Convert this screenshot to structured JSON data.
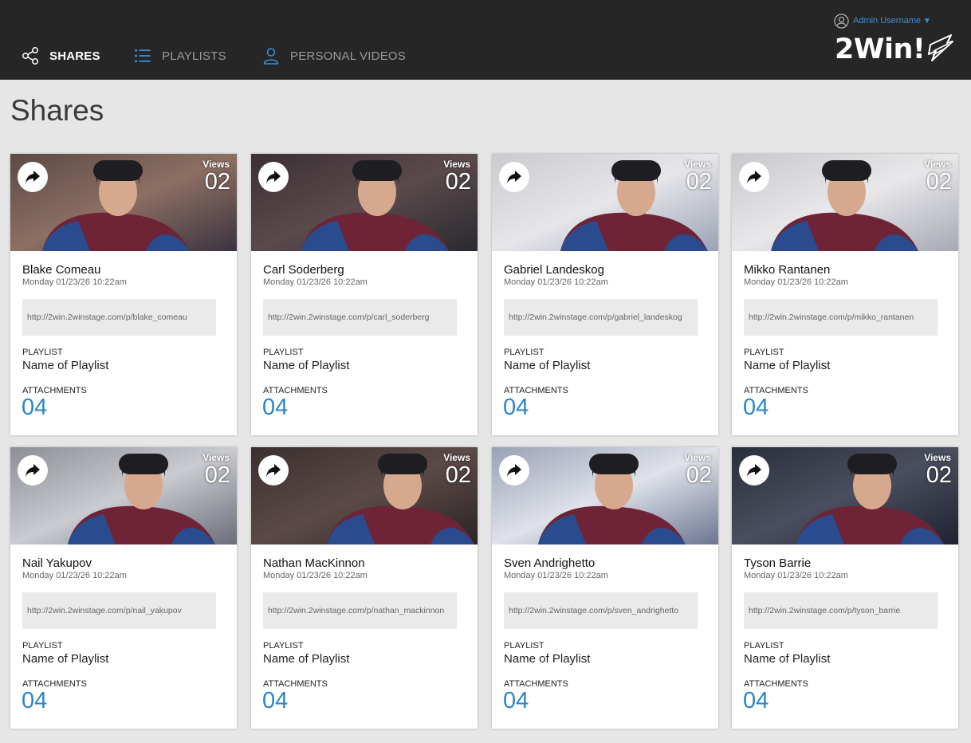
{
  "nav": {
    "items": [
      {
        "label": "SHARES",
        "icon": "share-icon"
      },
      {
        "label": "PLAYLISTS",
        "icon": "list-icon"
      },
      {
        "label": "PERSONAL VIDEOS",
        "icon": "user-icon"
      }
    ]
  },
  "user_menu": {
    "label": "Admin Username",
    "caret": "▼",
    "icon": "user-circle-icon"
  },
  "logo": {
    "text": "2Win!",
    "mark_icon": "lightning-flag-icon"
  },
  "page": {
    "title": "Shares"
  },
  "colors": {
    "topbar": "#262626",
    "background": "#e6e6e6",
    "accent": "#2a86c8",
    "link": "#3d8fd6",
    "jersey_burgundy": "#6e2436",
    "jersey_blue": "#2a4c8f"
  },
  "cards": [
    {
      "views_label": "Views",
      "views": "02",
      "name": "Blake Comeau",
      "date": "Monday 01/23/26 10:22am",
      "url": "http://2win.2winstage.com/p/blake_comeau",
      "playlist_label": "PLAYLIST",
      "playlist": "Name of Playlist",
      "attachments_label": "ATTACHMENTS",
      "attachments": "04"
    },
    {
      "views_label": "Views",
      "views": "02",
      "name": "Carl Soderberg",
      "date": "Monday 01/23/26 10:22am",
      "url": "http://2win.2winstage.com/p/carl_soderberg",
      "playlist_label": "PLAYLIST",
      "playlist": "Name of Playlist",
      "attachments_label": "ATTACHMENTS",
      "attachments": "04"
    },
    {
      "views_label": "Views",
      "views": "02",
      "name": "Gabriel Landeskog",
      "date": "Monday 01/23/26 10:22am",
      "url": "http://2win.2winstage.com/p/gabriel_landeskog",
      "playlist_label": "PLAYLIST",
      "playlist": "Name of Playlist",
      "attachments_label": "ATTACHMENTS",
      "attachments": "04"
    },
    {
      "views_label": "Views",
      "views": "02",
      "name": "Mikko Rantanen",
      "date": "Monday 01/23/26 10:22am",
      "url": "http://2win.2winstage.com/p/mikko_rantanen",
      "playlist_label": "PLAYLIST",
      "playlist": "Name of Playlist",
      "attachments_label": "ATTACHMENTS",
      "attachments": "04"
    },
    {
      "views_label": "Views",
      "views": "02",
      "name": "Nail Yakupov",
      "date": "Monday 01/23/26 10:22am",
      "url": "http://2win.2winstage.com/p/nail_yakupov",
      "playlist_label": "PLAYLIST",
      "playlist": "Name of Playlist",
      "attachments_label": "ATTACHMENTS",
      "attachments": "04"
    },
    {
      "views_label": "Views",
      "views": "02",
      "name": "Nathan MacKinnon",
      "date": "Monday 01/23/26 10:22am",
      "url": "http://2win.2winstage.com/p/nathan_mackinnon",
      "playlist_label": "PLAYLIST",
      "playlist": "Name of Playlist",
      "attachments_label": "ATTACHMENTS",
      "attachments": "04"
    },
    {
      "views_label": "Views",
      "views": "02",
      "name": "Sven Andrighetto",
      "date": "Monday 01/23/26 10:22am",
      "url": "http://2win.2winstage.com/p/sven_andrighetto",
      "playlist_label": "PLAYLIST",
      "playlist": "Name of Playlist",
      "attachments_label": "ATTACHMENTS",
      "attachments": "04"
    },
    {
      "views_label": "Views",
      "views": "02",
      "name": "Tyson Barrie",
      "date": "Monday 01/23/26 10:22am",
      "url": "http://2win.2winstage.com/p/tyson_barrie",
      "playlist_label": "PLAYLIST",
      "playlist": "Name of Playlist",
      "attachments_label": "ATTACHMENTS",
      "attachments": "04"
    }
  ]
}
